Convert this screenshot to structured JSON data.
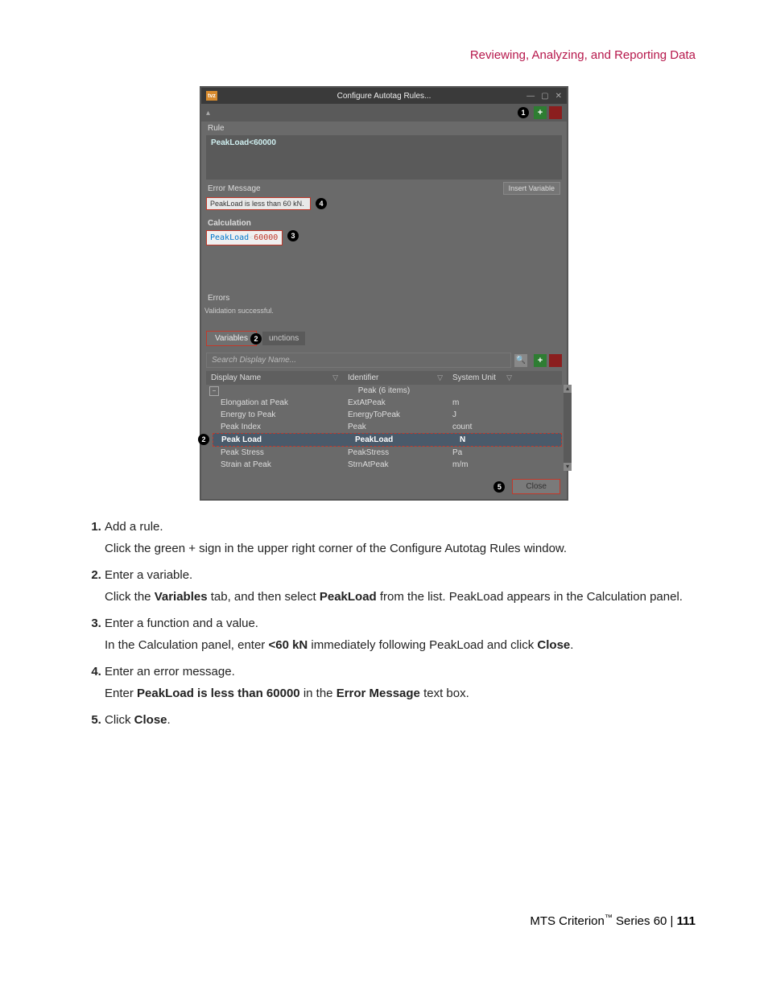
{
  "header": "Reviewing, Analyzing, and Reporting Data",
  "window": {
    "title": "Configure Autotag Rules...",
    "icon_text": "tvz",
    "rule_label": "Rule",
    "rule_value": "PeakLoad<60000",
    "errmsg_label": "Error Message",
    "insert_var": "Insert Variable",
    "errmsg_value": "PeakLoad is less than 60 kN.",
    "calc_label": "Calculation",
    "calc_var": "PeakLoad",
    "calc_op": "<",
    "calc_num": "60000",
    "errors_label": "Errors",
    "errors_text": "Validation successful.",
    "tab_variables": "Variables",
    "tab_functions": "unctions",
    "search_placeholder": "Search Display Name...",
    "columns": {
      "c1": "Display Name",
      "c2": "Identifier",
      "c3": "System Unit"
    },
    "group": "Peak (6 items)",
    "rows": [
      {
        "display": "Elongation at Peak",
        "id": "ExtAtPeak",
        "unit": "m"
      },
      {
        "display": "Energy to Peak",
        "id": "EnergyToPeak",
        "unit": "J"
      },
      {
        "display": "Peak Index",
        "id": "Peak",
        "unit": "count"
      },
      {
        "display": "Peak Load",
        "id": "PeakLoad",
        "unit": "N"
      },
      {
        "display": "Peak Stress",
        "id": "PeakStress",
        "unit": "Pa"
      },
      {
        "display": "Strain at Peak",
        "id": "StrnAtPeak",
        "unit": "m/m"
      }
    ],
    "close": "Close"
  },
  "callouts": {
    "c1": "1",
    "c2": "2",
    "c3": "3",
    "c4": "4",
    "c5": "5"
  },
  "steps": {
    "s1": {
      "title": "Add a rule.",
      "body": "Click the green + sign in the upper right corner of the Configure Autotag Rules window."
    },
    "s2": {
      "title": "Enter a variable.",
      "pre": "Click the ",
      "b1": "Variables",
      "mid": " tab, and then select ",
      "b2": "PeakLoad",
      "post": " from the list. PeakLoad appears in the Calculation panel."
    },
    "s3": {
      "title": "Enter a function and a value.",
      "pre": "In the Calculation panel, enter ",
      "b1": "<60 kN",
      "mid": " immediately following PeakLoad and click ",
      "b2": "Close",
      "post": "."
    },
    "s4": {
      "title": "Enter an error message.",
      "pre": "Enter ",
      "b1": "PeakLoad is less than 60000",
      "mid": " in the ",
      "b2": "Error Message",
      "post": " text box."
    },
    "s5": {
      "pre": "Click ",
      "b1": "Close",
      "post": "."
    }
  },
  "footer": {
    "product": "MTS Criterion",
    "series": " Series 60 | ",
    "page": "111"
  }
}
